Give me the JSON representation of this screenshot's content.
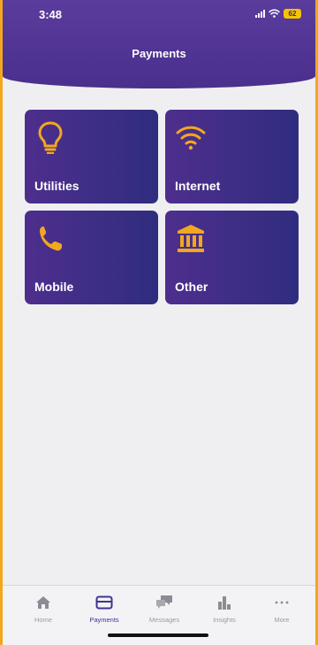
{
  "status_bar": {
    "time": "3:48",
    "battery": "62"
  },
  "header": {
    "title": "Payments"
  },
  "tiles": [
    {
      "label": "Utilities",
      "icon": "lightbulb-icon"
    },
    {
      "label": "Internet",
      "icon": "wifi-icon"
    },
    {
      "label": "Mobile",
      "icon": "phone-icon"
    },
    {
      "label": "Other",
      "icon": "bank-icon"
    }
  ],
  "bottom_nav": {
    "items": [
      {
        "label": "Home",
        "icon": "home-icon"
      },
      {
        "label": "Payments",
        "icon": "card-icon",
        "active": true
      },
      {
        "label": "Messages",
        "icon": "messages-icon"
      },
      {
        "label": "Insights",
        "icon": "bar-chart-icon"
      },
      {
        "label": "More",
        "icon": "more-icon"
      }
    ]
  },
  "colors": {
    "header": "#4a2f8d",
    "tile_start": "#4e2e8d",
    "tile_end": "#2f2d7f",
    "accent_icon": "#f2a81d",
    "frame_border": "#f2a81d",
    "active_nav": "#3d3396",
    "background": "#efeff1"
  }
}
